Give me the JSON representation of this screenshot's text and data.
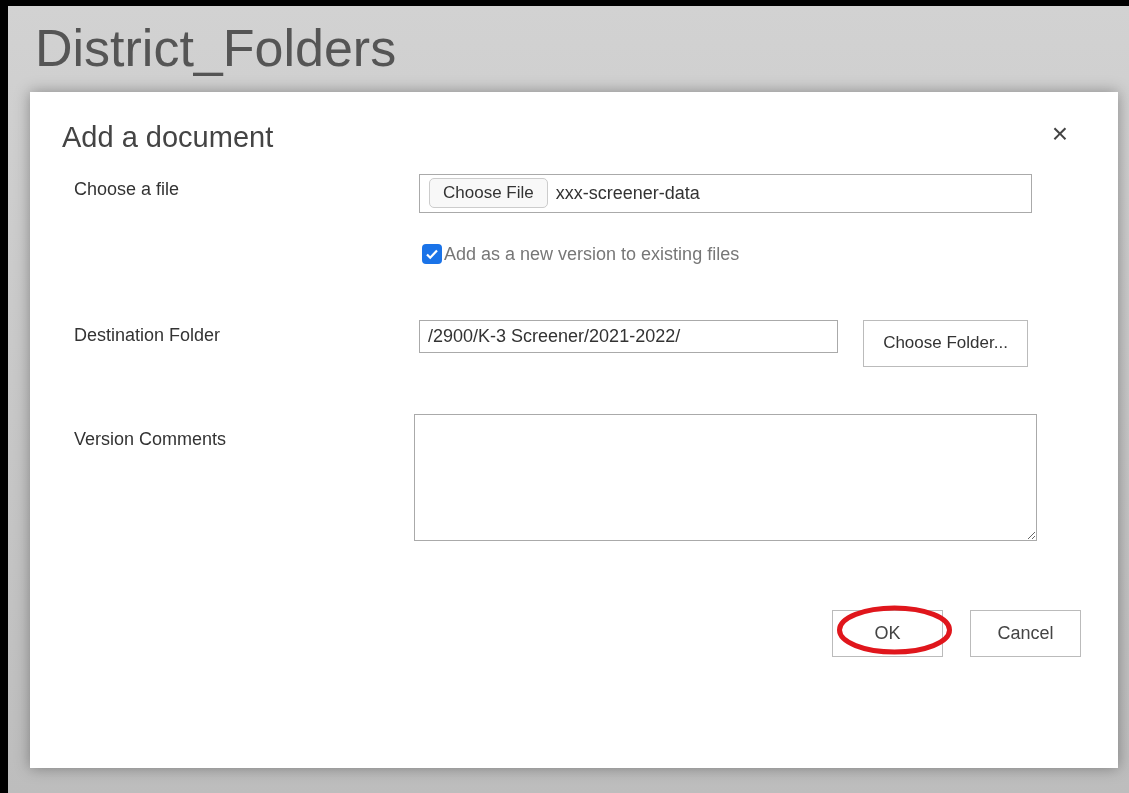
{
  "page": {
    "title": "District_Folders"
  },
  "dialog": {
    "title": "Add a document",
    "close": "×",
    "file": {
      "label": "Choose a file",
      "button": "Choose File",
      "value": "xxx-screener-data"
    },
    "new_version": {
      "label": "Add as a new version to existing files",
      "checked": true
    },
    "destination": {
      "label": "Destination Folder",
      "value": "/2900/K-3 Screener/2021-2022/",
      "button": "Choose Folder..."
    },
    "comments": {
      "label": "Version Comments"
    },
    "buttons": [
      {
        "label": "OK",
        "highlighted": true
      },
      {
        "label": "Cancel",
        "highlighted": false
      }
    ]
  }
}
